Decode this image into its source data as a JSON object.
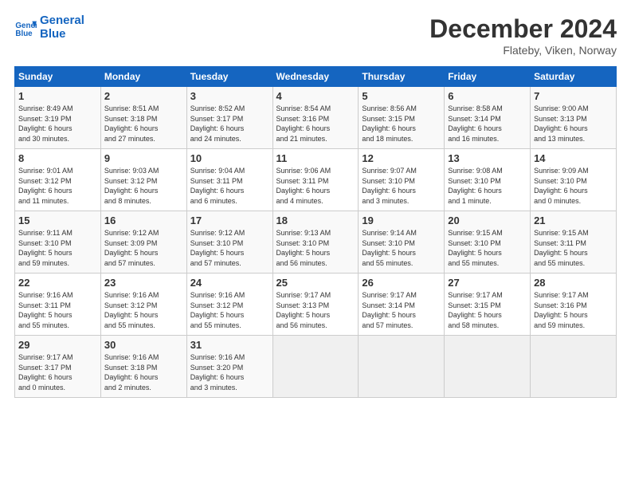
{
  "header": {
    "logo_line1": "General",
    "logo_line2": "Blue",
    "month": "December 2024",
    "location": "Flateby, Viken, Norway"
  },
  "days_of_week": [
    "Sunday",
    "Monday",
    "Tuesday",
    "Wednesday",
    "Thursday",
    "Friday",
    "Saturday"
  ],
  "weeks": [
    [
      {
        "day": 1,
        "info": "Sunrise: 8:49 AM\nSunset: 3:19 PM\nDaylight: 6 hours\nand 30 minutes."
      },
      {
        "day": 2,
        "info": "Sunrise: 8:51 AM\nSunset: 3:18 PM\nDaylight: 6 hours\nand 27 minutes."
      },
      {
        "day": 3,
        "info": "Sunrise: 8:52 AM\nSunset: 3:17 PM\nDaylight: 6 hours\nand 24 minutes."
      },
      {
        "day": 4,
        "info": "Sunrise: 8:54 AM\nSunset: 3:16 PM\nDaylight: 6 hours\nand 21 minutes."
      },
      {
        "day": 5,
        "info": "Sunrise: 8:56 AM\nSunset: 3:15 PM\nDaylight: 6 hours\nand 18 minutes."
      },
      {
        "day": 6,
        "info": "Sunrise: 8:58 AM\nSunset: 3:14 PM\nDaylight: 6 hours\nand 16 minutes."
      },
      {
        "day": 7,
        "info": "Sunrise: 9:00 AM\nSunset: 3:13 PM\nDaylight: 6 hours\nand 13 minutes."
      }
    ],
    [
      {
        "day": 8,
        "info": "Sunrise: 9:01 AM\nSunset: 3:12 PM\nDaylight: 6 hours\nand 11 minutes."
      },
      {
        "day": 9,
        "info": "Sunrise: 9:03 AM\nSunset: 3:12 PM\nDaylight: 6 hours\nand 8 minutes."
      },
      {
        "day": 10,
        "info": "Sunrise: 9:04 AM\nSunset: 3:11 PM\nDaylight: 6 hours\nand 6 minutes."
      },
      {
        "day": 11,
        "info": "Sunrise: 9:06 AM\nSunset: 3:11 PM\nDaylight: 6 hours\nand 4 minutes."
      },
      {
        "day": 12,
        "info": "Sunrise: 9:07 AM\nSunset: 3:10 PM\nDaylight: 6 hours\nand 3 minutes."
      },
      {
        "day": 13,
        "info": "Sunrise: 9:08 AM\nSunset: 3:10 PM\nDaylight: 6 hours\nand 1 minute."
      },
      {
        "day": 14,
        "info": "Sunrise: 9:09 AM\nSunset: 3:10 PM\nDaylight: 6 hours\nand 0 minutes."
      }
    ],
    [
      {
        "day": 15,
        "info": "Sunrise: 9:11 AM\nSunset: 3:10 PM\nDaylight: 5 hours\nand 59 minutes."
      },
      {
        "day": 16,
        "info": "Sunrise: 9:12 AM\nSunset: 3:09 PM\nDaylight: 5 hours\nand 57 minutes."
      },
      {
        "day": 17,
        "info": "Sunrise: 9:12 AM\nSunset: 3:10 PM\nDaylight: 5 hours\nand 57 minutes."
      },
      {
        "day": 18,
        "info": "Sunrise: 9:13 AM\nSunset: 3:10 PM\nDaylight: 5 hours\nand 56 minutes."
      },
      {
        "day": 19,
        "info": "Sunrise: 9:14 AM\nSunset: 3:10 PM\nDaylight: 5 hours\nand 55 minutes."
      },
      {
        "day": 20,
        "info": "Sunrise: 9:15 AM\nSunset: 3:10 PM\nDaylight: 5 hours\nand 55 minutes."
      },
      {
        "day": 21,
        "info": "Sunrise: 9:15 AM\nSunset: 3:11 PM\nDaylight: 5 hours\nand 55 minutes."
      }
    ],
    [
      {
        "day": 22,
        "info": "Sunrise: 9:16 AM\nSunset: 3:11 PM\nDaylight: 5 hours\nand 55 minutes."
      },
      {
        "day": 23,
        "info": "Sunrise: 9:16 AM\nSunset: 3:12 PM\nDaylight: 5 hours\nand 55 minutes."
      },
      {
        "day": 24,
        "info": "Sunrise: 9:16 AM\nSunset: 3:12 PM\nDaylight: 5 hours\nand 55 minutes."
      },
      {
        "day": 25,
        "info": "Sunrise: 9:17 AM\nSunset: 3:13 PM\nDaylight: 5 hours\nand 56 minutes."
      },
      {
        "day": 26,
        "info": "Sunrise: 9:17 AM\nSunset: 3:14 PM\nDaylight: 5 hours\nand 57 minutes."
      },
      {
        "day": 27,
        "info": "Sunrise: 9:17 AM\nSunset: 3:15 PM\nDaylight: 5 hours\nand 58 minutes."
      },
      {
        "day": 28,
        "info": "Sunrise: 9:17 AM\nSunset: 3:16 PM\nDaylight: 5 hours\nand 59 minutes."
      }
    ],
    [
      {
        "day": 29,
        "info": "Sunrise: 9:17 AM\nSunset: 3:17 PM\nDaylight: 6 hours\nand 0 minutes."
      },
      {
        "day": 30,
        "info": "Sunrise: 9:16 AM\nSunset: 3:18 PM\nDaylight: 6 hours\nand 2 minutes."
      },
      {
        "day": 31,
        "info": "Sunrise: 9:16 AM\nSunset: 3:20 PM\nDaylight: 6 hours\nand 3 minutes."
      },
      null,
      null,
      null,
      null
    ]
  ]
}
